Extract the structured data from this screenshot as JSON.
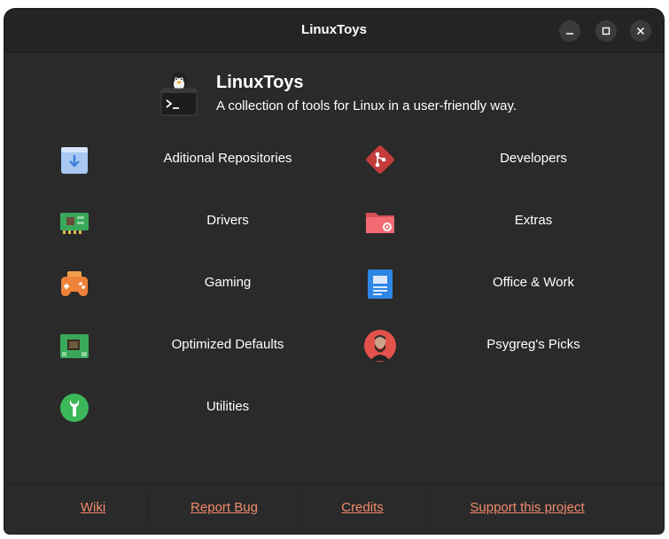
{
  "window": {
    "title": "LinuxToys",
    "controls": {
      "minimize": "–",
      "maximize": "□",
      "close": "✕"
    }
  },
  "header": {
    "name": "LinuxToys",
    "subtitle": "A collection of tools for Linux in a user-friendly way.",
    "logo_icon": "tux-terminal-icon"
  },
  "categories": [
    {
      "label": "Aditional Repositories",
      "icon": "repository-package-icon"
    },
    {
      "label": "Developers",
      "icon": "git-diamond-icon"
    },
    {
      "label": "Drivers",
      "icon": "circuit-board-icon"
    },
    {
      "label": "Extras",
      "icon": "folder-gear-icon"
    },
    {
      "label": "Gaming",
      "icon": "gamepad-icon"
    },
    {
      "label": "Office & Work",
      "icon": "document-icon"
    },
    {
      "label": "Optimized Defaults",
      "icon": "cpu-chip-icon"
    },
    {
      "label": "Psygreg's Picks",
      "icon": "avatar-icon"
    },
    {
      "label": "Utilities",
      "icon": "wrench-icon"
    }
  ],
  "footer": {
    "links": [
      "Wiki",
      "Report Bug",
      "Credits",
      "Support this project"
    ]
  },
  "colors": {
    "window_bg": "#2a2a2a",
    "titlebar_bg": "#242424",
    "link": "#f08a6a",
    "text": "#ffffff"
  }
}
